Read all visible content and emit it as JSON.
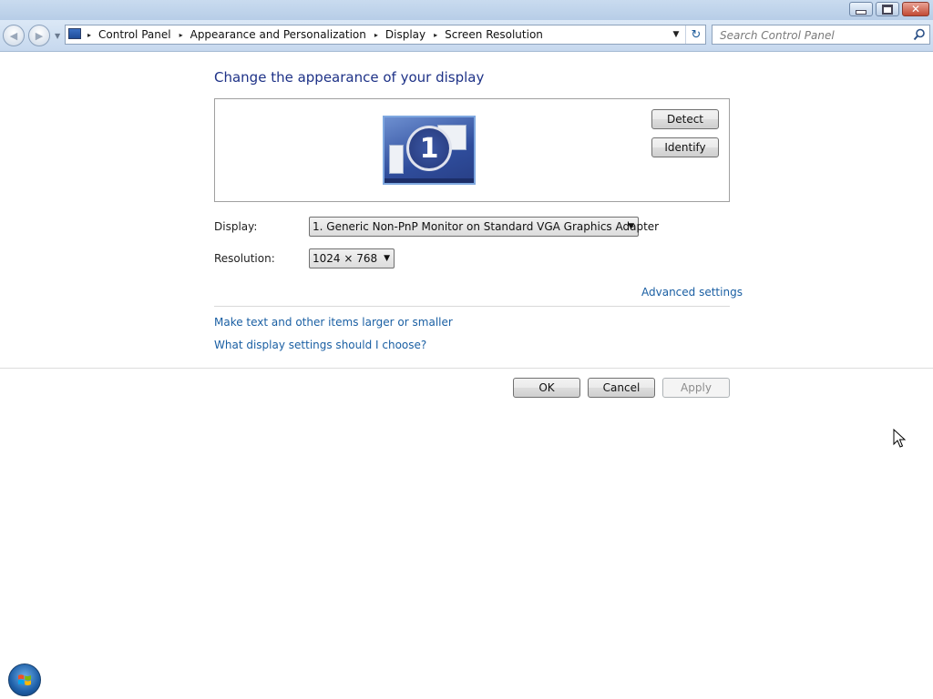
{
  "window": {
    "minimize_icon": "minimize-icon",
    "restore_icon": "restore-icon",
    "close_icon": "close-icon",
    "close_glyph": "✕"
  },
  "nav": {
    "back_glyph": "◀",
    "forward_glyph": "▶",
    "history_glyph": "▼"
  },
  "address": {
    "breadcrumbs": [
      "Control Panel",
      "Appearance and Personalization",
      "Display",
      "Screen Resolution"
    ],
    "separator": "▸",
    "dropdown_glyph": "▼",
    "refresh_glyph": "↻"
  },
  "search": {
    "placeholder": "Search Control Panel"
  },
  "main": {
    "title": "Change the appearance of your display",
    "monitor_number": "1",
    "detect_label": "Detect",
    "identify_label": "Identify",
    "display_label": "Display:",
    "display_value": "1. Generic Non-PnP Monitor on Standard VGA Graphics Adapter",
    "resolution_label": "Resolution:",
    "resolution_value": "1024 × 768",
    "advanced_link": "Advanced settings",
    "text_size_link": "Make text and other items larger or smaller",
    "help_link": "What display settings should I choose?"
  },
  "footer": {
    "ok_label": "OK",
    "cancel_label": "Cancel",
    "apply_label": "Apply"
  },
  "colors": {
    "title_blue": "#1e3287",
    "link_blue": "#1a5fa3"
  }
}
